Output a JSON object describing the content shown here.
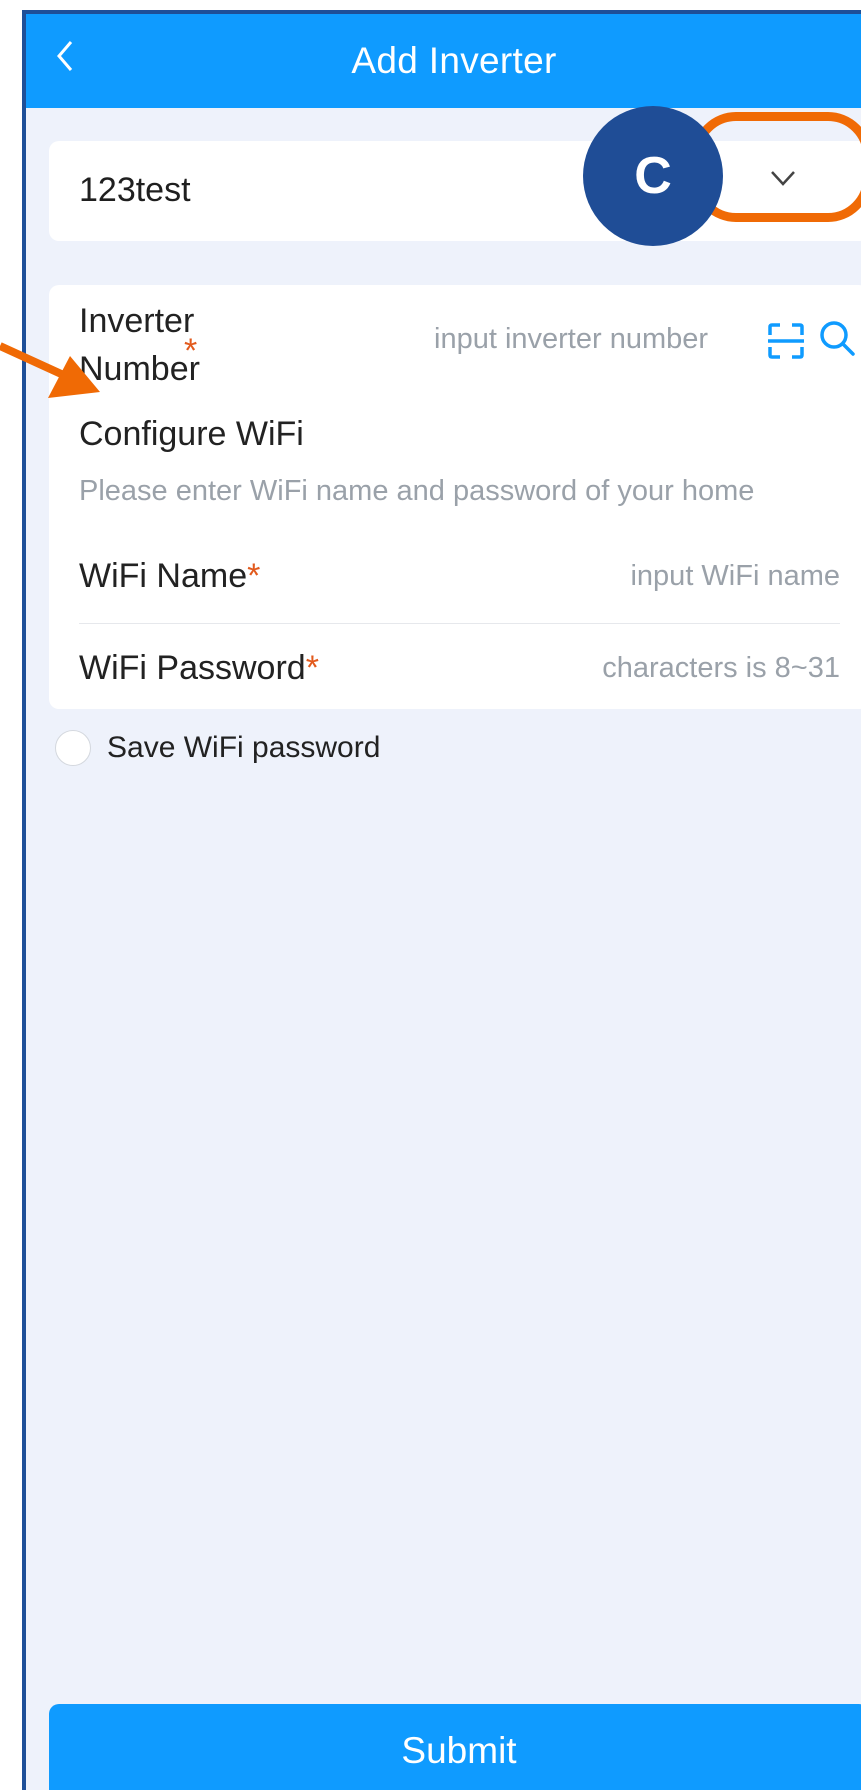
{
  "header": {
    "title": "Add Inverter"
  },
  "plant": {
    "name": "123test"
  },
  "annotation": {
    "badge_letter": "C",
    "highlight_color": "#f06a05",
    "badge_color": "#1f4d96"
  },
  "form": {
    "inverter_label": "Inverter Number",
    "inverter_placeholder": "input inverter number",
    "configure_title": "Configure WiFi",
    "configure_desc": "Please enter WiFi name and password of your home",
    "wifi_name_label": "WiFi Name",
    "wifi_name_placeholder": "input WiFi name",
    "wifi_password_label": "WiFi Password",
    "wifi_password_placeholder": "characters is 8~31",
    "required_mark": "*"
  },
  "save_wifi": {
    "label": "Save WiFi password"
  },
  "submit": {
    "label": "Submit"
  },
  "icons": [
    "back-icon",
    "chevron-down-icon",
    "scan-icon",
    "search-icon"
  ],
  "colors": {
    "primary": "#0f9bff",
    "required": "#e25a1d",
    "background": "#eef2fb"
  }
}
